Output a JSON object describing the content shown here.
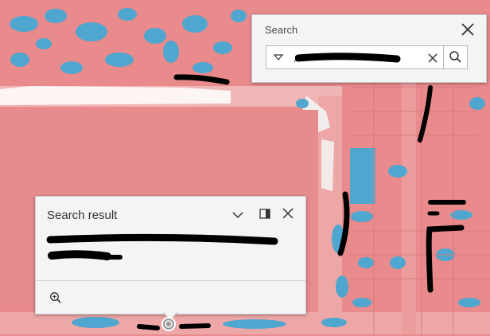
{
  "search_widget": {
    "title": "Search",
    "query": ", ...",
    "icons": {
      "close": "close-icon",
      "source": "caret-down-icon",
      "clear": "clear-icon",
      "submit": "search-icon"
    }
  },
  "popup": {
    "title": "Search result",
    "icons": {
      "collapse": "chevron-down-icon",
      "dock": "dock-icon",
      "close": "close-icon",
      "zoom": "zoom-to-icon"
    }
  },
  "colors": {
    "map_zone": "#e98a8c",
    "map_water": "#4fa6cf",
    "map_road": "#f0b4b4",
    "panel_bg": "#f4f4f4",
    "redaction": "#000000"
  }
}
